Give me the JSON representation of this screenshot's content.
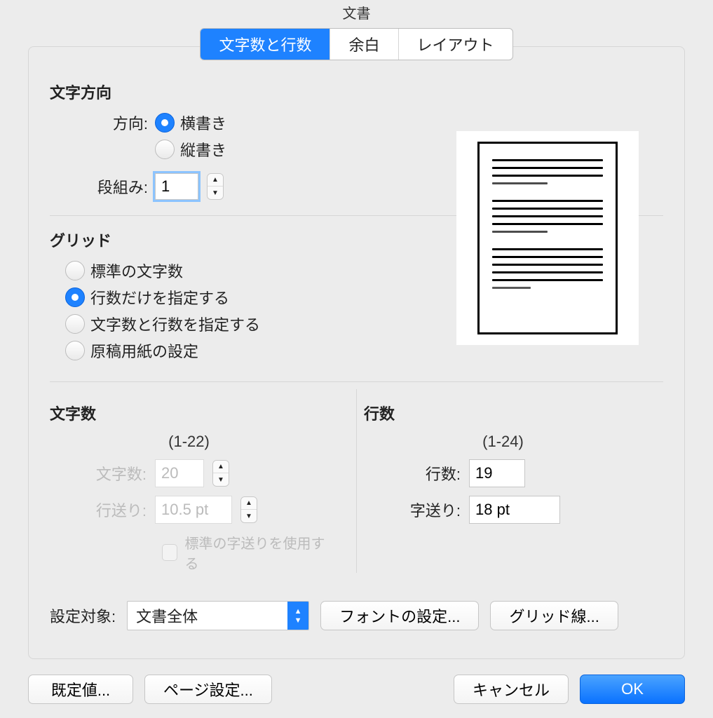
{
  "title": "文書",
  "tabs": [
    "文字数と行数",
    "余白",
    "レイアウト"
  ],
  "section_direction": "文字方向",
  "direction_label": "方向:",
  "direction_horiz": "横書き",
  "direction_vert": "縦書き",
  "cols_label": "段組み:",
  "cols_value": "1",
  "section_grid": "グリッド",
  "grid_opts": [
    "標準の文字数",
    "行数だけを指定する",
    "文字数と行数を指定する",
    "原稿用紙の設定"
  ],
  "section_chars": "文字数",
  "chars_range": "(1-22)",
  "chars_label": "文字数:",
  "chars_value": "20",
  "linepitch_label": "行送り:",
  "linepitch_value": "10.5 pt",
  "use_std_pitch": "標準の字送りを使用する",
  "section_lines": "行数",
  "lines_range": "(1-24)",
  "lines_label": "行数:",
  "lines_value": "19",
  "charpitch_label": "字送り:",
  "charpitch_value": "18 pt",
  "apply_label": "設定対象:",
  "apply_value": "文書全体",
  "font_btn": "フォントの設定...",
  "gridline_btn": "グリッド線...",
  "default_btn": "既定値...",
  "pagesetup_btn": "ページ設定...",
  "cancel_btn": "キャンセル",
  "ok_btn": "OK"
}
